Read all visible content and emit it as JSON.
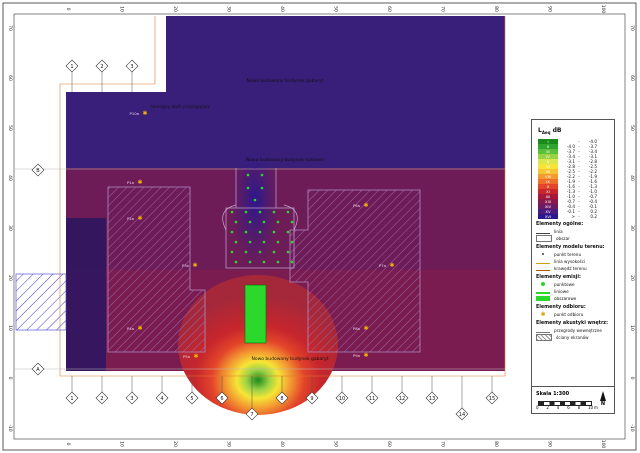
{
  "frame": {
    "x_ticks": [
      "0",
      "10",
      "20",
      "30",
      "40",
      "50",
      "60",
      "70",
      "80",
      "90",
      "100"
    ],
    "y_ticks": [
      "70",
      "60",
      "50",
      "40",
      "30",
      "20",
      "10",
      "0",
      "-10"
    ]
  },
  "axes": {
    "bottom_numbers": [
      "1",
      "2",
      "3",
      "4",
      "5",
      "6",
      "7",
      "8",
      "9",
      "10",
      "11",
      "12",
      "13",
      "14",
      "15"
    ],
    "top_numbers": [
      "1",
      "2",
      "3"
    ],
    "side_letters": [
      "B",
      "A"
    ]
  },
  "map_labels": [
    "Nowo budowany budynek gabaryt",
    "Istniejący dach przylegający",
    "Nowo budowany budynek kotłowni",
    "Nowo budowany budynek gabaryt"
  ],
  "receptor_labels": [
    "P1a",
    "P2a",
    "P3a",
    "P4a",
    "P5a",
    "P6a",
    "P7a",
    "P8a",
    "P9a",
    "P10a"
  ],
  "legend": {
    "title": "L",
    "title_sub": "Aeq",
    "title_unit": "dB",
    "header": "L",
    "bins": [
      {
        "code": "I",
        "from": "",
        "to": "-4.0",
        "color": "#1a8a1a"
      },
      {
        "code": "II",
        "from": "-4.0",
        "to": "-3.7",
        "color": "#2fa52f"
      },
      {
        "code": "III",
        "from": "-3.7",
        "to": "-3.4",
        "color": "#5cbf3a"
      },
      {
        "code": "IV",
        "from": "-3.4",
        "to": "-3.1",
        "color": "#9bd245"
      },
      {
        "code": "V",
        "from": "-3.1",
        "to": "-2.8",
        "color": "#d9e84e"
      },
      {
        "code": "VI",
        "from": "-2.8",
        "to": "-2.5",
        "color": "#f6e536"
      },
      {
        "code": "VII",
        "from": "-2.5",
        "to": "-2.2",
        "color": "#f6c534"
      },
      {
        "code": "VIII",
        "from": "-2.2",
        "to": "-1.9",
        "color": "#f39a31"
      },
      {
        "code": "IX",
        "from": "-1.9",
        "to": "-1.6",
        "color": "#ee6e2c"
      },
      {
        "code": "X",
        "from": "-1.6",
        "to": "-1.3",
        "color": "#e3452a"
      },
      {
        "code": "XI",
        "from": "-1.3",
        "to": "-1.0",
        "color": "#c7262c"
      },
      {
        "code": "XII",
        "from": "-1.0",
        "to": "-0.7",
        "color": "#a51a3a"
      },
      {
        "code": "XIII",
        "from": "-0.7",
        "to": "-0.4",
        "color": "#8a1a4d"
      },
      {
        "code": "XIV",
        "from": "-0.4",
        "to": "-0.1",
        "color": "#6d1a66"
      },
      {
        "code": "XV",
        "from": "-0.1",
        "to": "0.2",
        "color": "#4a1a80"
      },
      {
        "code": "XVI",
        "from": ">",
        "to": "0.2",
        "color": "#2c168f"
      }
    ],
    "sections": {
      "general": {
        "title": "Elementy ogólne:",
        "items": [
          "linia",
          "obszar"
        ]
      },
      "terrain": {
        "title": "Elementy modelu terenu:",
        "items": [
          "punkt terenu",
          "linia wysokości",
          "krawędź terenu"
        ]
      },
      "emission": {
        "title": "Elementy emisji:",
        "items": [
          "punktowe",
          "liniowe",
          "obszarowe"
        ]
      },
      "receivers": {
        "title": "Elementy odbioru:",
        "items": [
          "punkt odbioru"
        ]
      },
      "acoustic": {
        "title": "Elementy akustyki wnętrz:",
        "items": [
          "przegrody wewnętrzne",
          "ściany ekranów"
        ]
      }
    }
  },
  "scale": {
    "title": "Skala 1:300",
    "ticks": [
      "0",
      "2",
      "4",
      "6",
      "8",
      "10"
    ],
    "unit": "m",
    "north_label": "N"
  },
  "colors": {
    "outer_zone": "#3a1f7a",
    "mid_zone": "#6e1c58",
    "warm_zone": "#a5283a",
    "hatch": "#8a5aa0"
  }
}
